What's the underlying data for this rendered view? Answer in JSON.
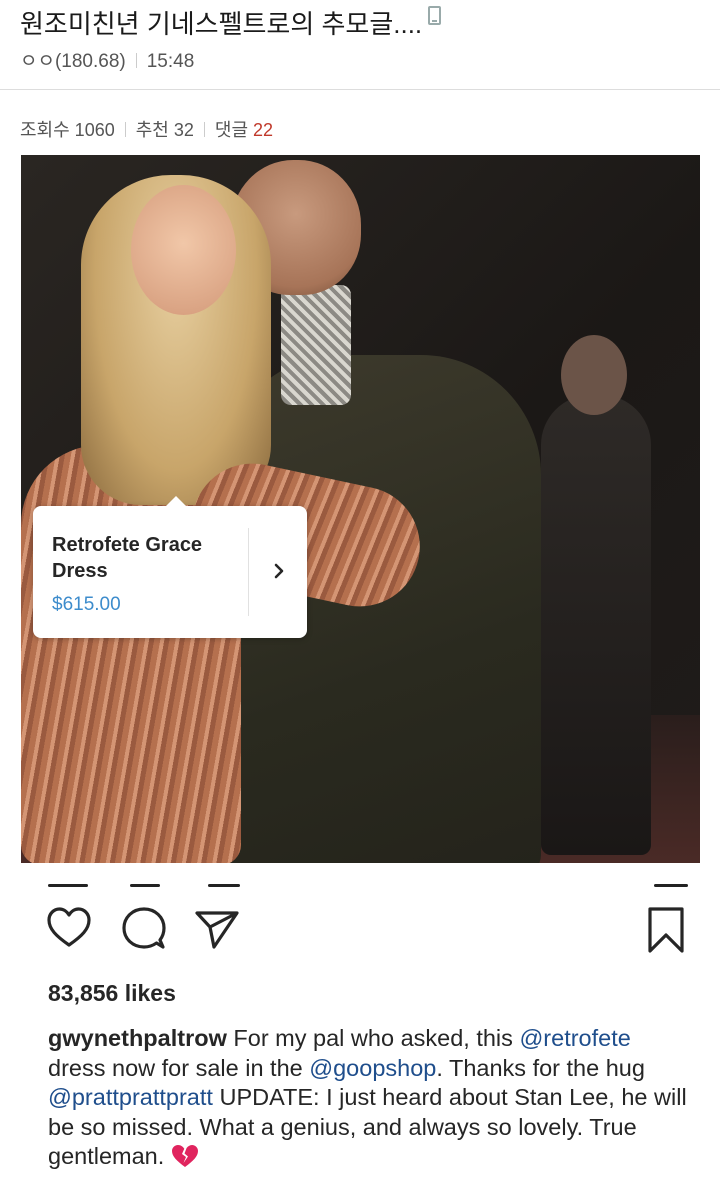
{
  "post": {
    "title": "원조미친년 기네스펠트로의 추모글....",
    "author": "ㅇㅇ(180.68)",
    "time": "15:48",
    "views_label": "조회수 1060",
    "recommend_label": "추천 32",
    "comments_label": "댓글",
    "comments_count": "22"
  },
  "instagram": {
    "product_tag": {
      "name": "Retrofete Grace Dress",
      "price": "$615.00"
    },
    "likes": "83,856 likes",
    "caption": {
      "username": "gwynethpaltrow",
      "text_1": "For my pal who asked, this",
      "mention_1": "@retrofete",
      "text_2": "dress now for sale in the",
      "mention_2": "@goopshop",
      "text_3": ". Thanks for the hug",
      "mention_3": "@prattprattpratt",
      "text_4": "UPDATE: I just heard about Stan Lee, he will be so missed. What a genius, and always so lovely. True gentleman."
    },
    "icons": {
      "like": "heart-icon",
      "comment": "comment-bubble-icon",
      "share": "paper-plane-icon",
      "save": "bookmark-icon",
      "caption_emoji": "broken-heart-icon"
    }
  },
  "colors": {
    "mention": "#1f4e8c",
    "price": "#3d8ccc",
    "comment_count": "#c0392b",
    "broken_heart": "#e0245e"
  }
}
